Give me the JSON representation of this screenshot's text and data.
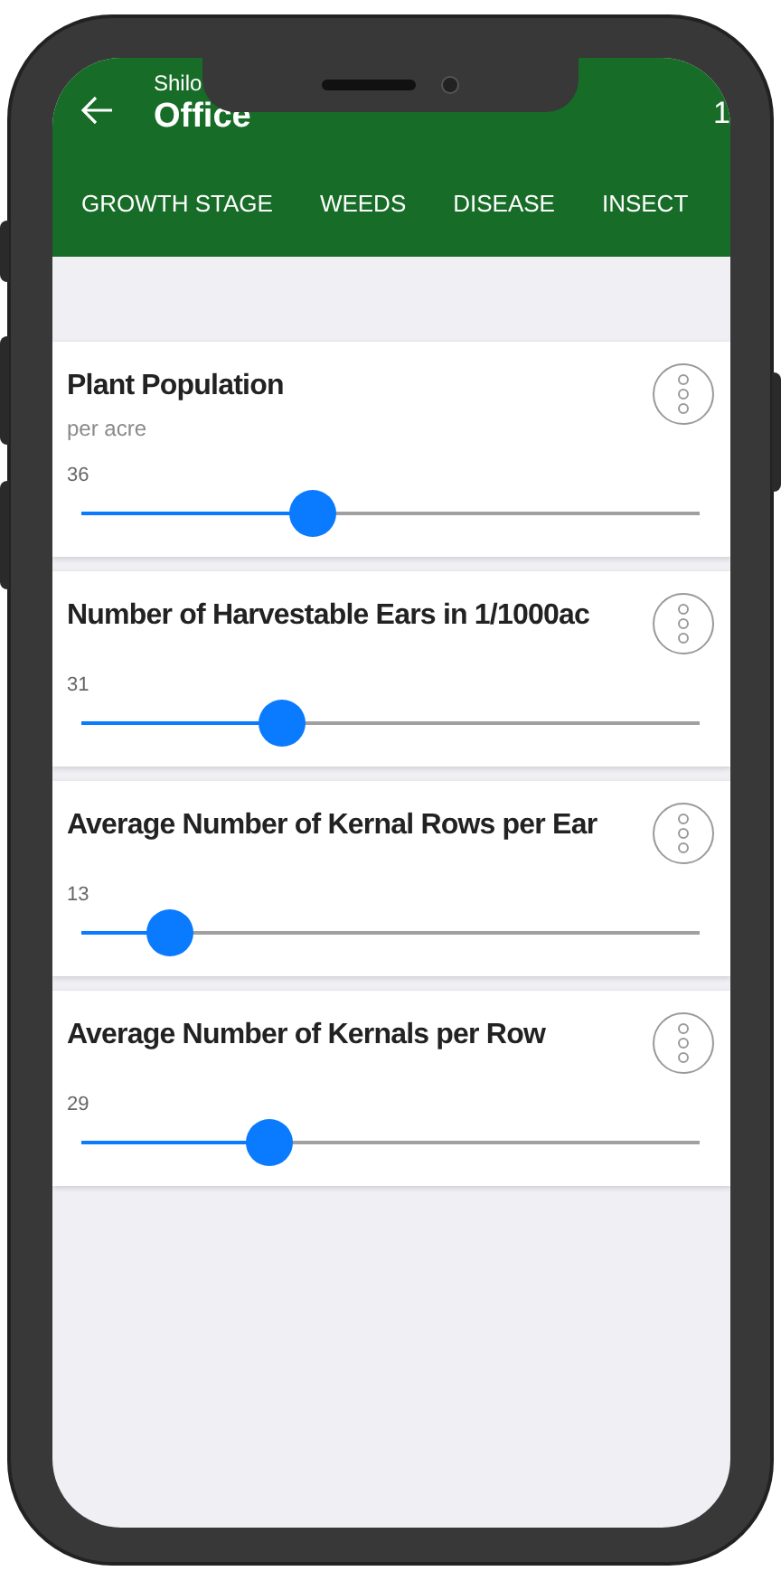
{
  "header": {
    "subtitle": "Shilo",
    "title": "Office",
    "right_text": "1"
  },
  "tabs": [
    {
      "label": "GROWTH STAGE",
      "selected": false
    },
    {
      "label": "WEEDS",
      "selected": false
    },
    {
      "label": "DISEASE",
      "selected": false
    },
    {
      "label": "INSECT",
      "selected": false
    }
  ],
  "cards": [
    {
      "title": "Plant Population",
      "subtitle": "per acre",
      "value": "36",
      "level": 0.374
    },
    {
      "title": "Number of Harvestable Ears in 1/1000ac",
      "value": "31",
      "level": 0.325
    },
    {
      "title": "Average Number of Kernal Rows per Ear",
      "value": "13",
      "level": 0.143
    },
    {
      "title": "Average Number of Kernals per Row",
      "value": "29",
      "level": 0.304
    }
  ]
}
